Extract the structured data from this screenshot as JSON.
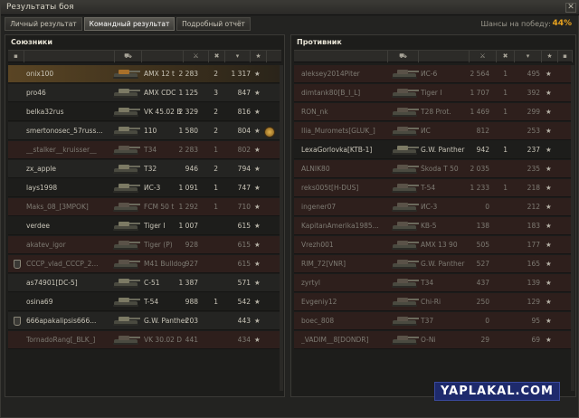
{
  "window": {
    "title": "Результаты боя"
  },
  "tabs": [
    "Личный результат",
    "Командный результат",
    "Подробный отчёт"
  ],
  "win_chance": {
    "label": "Шансы на победу:",
    "value": "44%"
  },
  "allies": {
    "title": "Союзники",
    "rows": [
      {
        "name": "onix100",
        "tank": "AMX 12 t",
        "damage": "2 283",
        "kills": "2",
        "xp": "1 317",
        "status": "self"
      },
      {
        "name": "pro46",
        "tank": "AMX CDC",
        "damage": "1 125",
        "kills": "3",
        "xp": "847",
        "status": "alive"
      },
      {
        "name": "belka32rus",
        "tank": "VK 45.02 B",
        "damage": "2 329",
        "kills": "2",
        "xp": "816",
        "status": "alive"
      },
      {
        "name": "smertonosec_57russ...",
        "tank": "110",
        "damage": "1 580",
        "kills": "2",
        "xp": "804",
        "status": "alive",
        "medal": true
      },
      {
        "name": "__stalker__kruisser__",
        "tank": "T34",
        "damage": "2 283",
        "kills": "1",
        "xp": "802",
        "status": "dead"
      },
      {
        "name": "zx_apple",
        "tank": "T32",
        "damage": "946",
        "kills": "2",
        "xp": "794",
        "status": "alive"
      },
      {
        "name": "lays1998",
        "tank": "ИС-3",
        "damage": "1 091",
        "kills": "1",
        "xp": "747",
        "status": "alive"
      },
      {
        "name": "Maks_08_[3MPOK]",
        "tank": "FCM 50 t",
        "damage": "1 292",
        "kills": "1",
        "xp": "710",
        "status": "dead"
      },
      {
        "name": "verdee",
        "tank": "Tiger I",
        "damage": "1 007",
        "kills": "",
        "xp": "615",
        "status": "alive"
      },
      {
        "name": "akatev_igor",
        "tank": "Tiger (P)",
        "damage": "928",
        "kills": "",
        "xp": "615",
        "status": "dead"
      },
      {
        "name": "CCCP_vlad_CCCP_2...",
        "tank": "M41 Bulldog",
        "damage": "927",
        "kills": "",
        "xp": "615",
        "status": "dead",
        "platoon": true
      },
      {
        "name": "as74901[DC-5]",
        "tank": "C-51",
        "damage": "1 387",
        "kills": "",
        "xp": "571",
        "status": "alive"
      },
      {
        "name": "osina69",
        "tank": "T-54",
        "damage": "988",
        "kills": "1",
        "xp": "542",
        "status": "alive"
      },
      {
        "name": "666apakalipsis666...",
        "tank": "G.W. Panther",
        "damage": "203",
        "kills": "",
        "xp": "443",
        "status": "alive",
        "platoon": true
      },
      {
        "name": "TornadoRang[_BLK_]",
        "tank": "VK 30.02 D",
        "damage": "441",
        "kills": "",
        "xp": "434",
        "status": "dead"
      }
    ]
  },
  "enemies": {
    "title": "Противник",
    "rows": [
      {
        "name": "aleksey2014Piter",
        "tank": "ИС-6",
        "damage": "2 564",
        "kills": "1",
        "xp": "495",
        "status": "dead"
      },
      {
        "name": "dimtank80[B_I_L]",
        "tank": "Tiger I",
        "damage": "1 707",
        "kills": "1",
        "xp": "392",
        "status": "dead"
      },
      {
        "name": "RON_nk",
        "tank": "T28 Prot.",
        "damage": "1 469",
        "kills": "1",
        "xp": "299",
        "status": "dead"
      },
      {
        "name": "Ilia_Muromets[GLUK_]",
        "tank": "ИС",
        "damage": "812",
        "kills": "",
        "xp": "253",
        "status": "dead"
      },
      {
        "name": "LexaGorlovka[KTB-1]",
        "tank": "G.W. Panther",
        "damage": "942",
        "kills": "1",
        "xp": "237",
        "status": "alive"
      },
      {
        "name": "ALNIK80",
        "tank": "Škoda T 50",
        "damage": "2 035",
        "kills": "",
        "xp": "235",
        "status": "dead"
      },
      {
        "name": "reks005t[H-DUS]",
        "tank": "T-54",
        "damage": "1 233",
        "kills": "1",
        "xp": "218",
        "status": "dead"
      },
      {
        "name": "ingener07",
        "tank": "ИС-3",
        "damage": "0",
        "kills": "",
        "xp": "212",
        "status": "dead"
      },
      {
        "name": "KapitanAmerika1985...",
        "tank": "KB-5",
        "damage": "138",
        "kills": "",
        "xp": "183",
        "status": "dead"
      },
      {
        "name": "Vrezh001",
        "tank": "AMX 13 90",
        "damage": "505",
        "kills": "",
        "xp": "177",
        "status": "dead"
      },
      {
        "name": "RIM_72[VNR]",
        "tank": "G.W. Panther",
        "damage": "527",
        "kills": "",
        "xp": "165",
        "status": "dead"
      },
      {
        "name": "zyrtyl",
        "tank": "T34",
        "damage": "437",
        "kills": "",
        "xp": "139",
        "status": "dead"
      },
      {
        "name": "Evgeniy12",
        "tank": "Chi-Ri",
        "damage": "250",
        "kills": "",
        "xp": "129",
        "status": "dead"
      },
      {
        "name": "boec_808",
        "tank": "T37",
        "damage": "0",
        "kills": "",
        "xp": "95",
        "status": "dead"
      },
      {
        "name": "_VADIM__8[DONDR]",
        "tank": "O-Ni",
        "damage": "29",
        "kills": "",
        "xp": "69",
        "status": "dead"
      }
    ]
  },
  "watermark": "YAPLAKAL.COM",
  "colors": {
    "accent": "#e6a11f",
    "self_row": "#5a4524",
    "dead_row": "#6e281e"
  }
}
